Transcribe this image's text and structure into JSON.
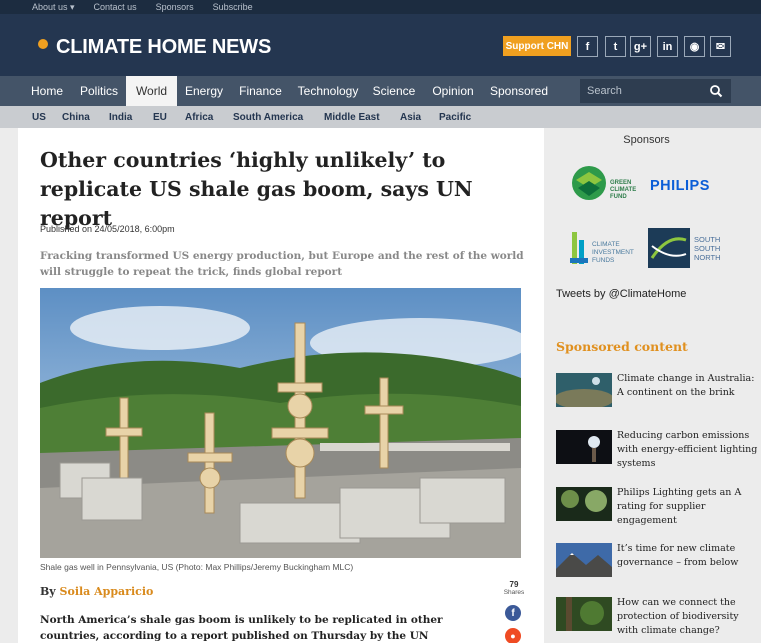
{
  "topbar": {
    "items": [
      "About us ▾",
      "Contact us",
      "Sponsors",
      "Subscribe"
    ]
  },
  "header": {
    "brand": "CLIMATE HOME NEWS",
    "support_label": "Support CHN",
    "social": [
      {
        "icon": "facebook-icon",
        "glyph": "f"
      },
      {
        "icon": "twitter-icon",
        "glyph": "t"
      },
      {
        "icon": "google-plus-icon",
        "glyph": "g+"
      },
      {
        "icon": "linkedin-icon",
        "glyph": "in"
      },
      {
        "icon": "rss-icon",
        "glyph": "◉"
      },
      {
        "icon": "email-icon",
        "glyph": "✉"
      }
    ]
  },
  "nav": {
    "items": [
      "Home",
      "Politics",
      "World",
      "Energy",
      "Finance",
      "Technology",
      "Science",
      "Opinion",
      "Sponsored"
    ],
    "active": "World",
    "search_placeholder": "Search"
  },
  "regions": [
    "US",
    "China",
    "India",
    "EU",
    "Africa",
    "South America",
    "Middle East",
    "Asia",
    "Pacific"
  ],
  "article": {
    "headline": "Other countries ‘highly unlikely’ to replicate US shale gas boom, says UN report",
    "published": "Published on 24/05/2018, 6:00pm",
    "standfirst": "Fracking transformed US energy production, but Europe and the rest of the world will struggle to repeat the trick, finds global report",
    "caption": "Shale gas well in Pennsylvania, US (Photo: Max Phillips/Jeremy Buckingham MLC)",
    "byline_prefix": "By",
    "author": "Soila Apparicio",
    "shares_count": "79",
    "shares_label": "Shares",
    "lead": "North America’s shale gas boom is unlikely to be replicated in other countries, according to a report published on Thursday by the UN"
  },
  "sidebar": {
    "sponsors_title": "Sponsors",
    "sponsors": [
      {
        "name": "GREEN CLIMATE FUND",
        "lines": [
          "GREEN",
          "CLIMATE",
          "FUND"
        ]
      },
      {
        "name": "PHILIPS",
        "lines": [
          "PHILIPS"
        ]
      },
      {
        "name": "CLIMATE INVESTMENT FUNDS",
        "lines": [
          "CLIMATE",
          "INVESTMENT",
          "FUNDS"
        ]
      },
      {
        "name": "SOUTH SOUTH NORTH",
        "lines": [
          "SOUTH",
          "SOUTH",
          "NORTH"
        ]
      }
    ],
    "tweets_label": "Tweets by @ClimateHome",
    "sponsored_heading": "Sponsored content",
    "sponsored": [
      {
        "title": "Climate change in Australia: A continent on the brink"
      },
      {
        "title": "Reducing carbon emissions with energy-efficient lighting systems"
      },
      {
        "title": "Philips Lighting gets an A rating for supplier engagement"
      },
      {
        "title": "It’s time for new climate governance – from below"
      },
      {
        "title": "How can we connect the protection of biodiversity with climate change?"
      }
    ]
  },
  "colors": {
    "header_bg": "#243650",
    "nav_bg": "#445468",
    "accent_orange": "#f0a020",
    "sponsored_heading": "#e0901f"
  }
}
